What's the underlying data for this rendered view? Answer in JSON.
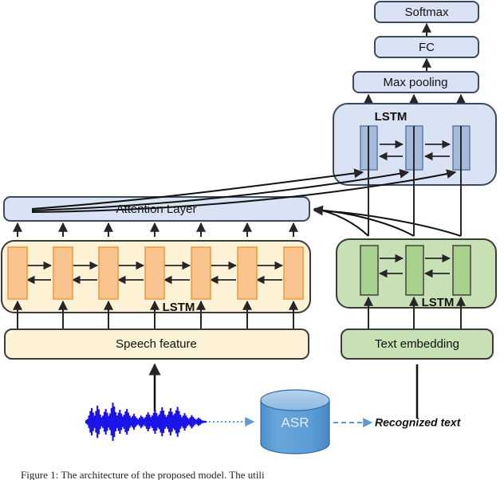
{
  "figure": {
    "caption": "Figure 1: The architecture of the proposed model. The utili",
    "colors": {
      "blue_fill": "#dae3f3",
      "blue_cell": "#a6bada",
      "blue_stroke": "#3b4a5c",
      "orange_fill": "#fdf1d6",
      "orange_cell": "#f9c48e",
      "orange_stroke": "#ef9c42",
      "green_fill": "#c7e0b4",
      "green_cell": "#a9d18e",
      "green_stroke": "#4a4a4a",
      "asr_fill": "#5b9bd5",
      "asr_top": "#9dc3e6",
      "wave": "#1a14e8",
      "dash": "#5b9bd5",
      "line": "#262626"
    }
  },
  "blocks": {
    "softmax": {
      "label": "Softmax"
    },
    "fc": {
      "label": "FC"
    },
    "max_pooling": {
      "label": "Max pooling"
    },
    "attention": {
      "label": "Attention Layer"
    },
    "speech_feature": {
      "label": "Speech feature"
    },
    "text_embedding": {
      "label": "Text embedding"
    },
    "asr": {
      "label": "ASR"
    },
    "recognized_text": {
      "label": "Recognized text"
    }
  },
  "lstm": {
    "top_blue": {
      "label": "LSTM",
      "cell_count": 3,
      "kind": "bidirectional"
    },
    "left_orange": {
      "label": "LSTM",
      "cell_count": 7,
      "kind": "bidirectional"
    },
    "right_green": {
      "label": "LSTM",
      "cell_count": 3,
      "kind": "bidirectional"
    }
  },
  "waveform": {
    "name": "speech-waveform",
    "amplitudes": [
      0.08,
      0.14,
      0.3,
      0.52,
      0.66,
      0.45,
      0.3,
      0.52,
      0.78,
      0.6,
      0.35,
      0.22,
      0.3,
      0.48,
      0.62,
      0.44,
      0.28,
      0.4,
      0.66,
      0.92,
      0.74,
      0.46,
      0.3,
      0.44,
      0.58,
      0.4,
      0.26,
      0.34,
      0.5,
      0.62,
      0.44,
      0.3,
      0.2,
      0.28,
      0.38,
      0.26,
      0.18,
      0.12,
      0.2,
      0.3,
      0.24,
      0.16,
      0.22,
      0.34,
      0.46,
      0.34,
      0.22,
      0.3,
      0.44,
      0.58,
      0.42,
      0.28,
      0.36,
      0.52,
      0.7,
      0.54,
      0.34,
      0.24,
      0.34,
      0.5,
      0.66,
      0.48,
      0.32,
      0.4,
      0.56,
      0.72,
      0.52,
      0.34,
      0.22,
      0.3,
      0.42,
      0.3,
      0.2,
      0.14,
      0.22,
      0.32,
      0.24,
      0.16,
      0.1,
      0.14,
      0.2,
      0.14,
      0.09,
      0.06,
      0.05,
      0.04
    ]
  }
}
